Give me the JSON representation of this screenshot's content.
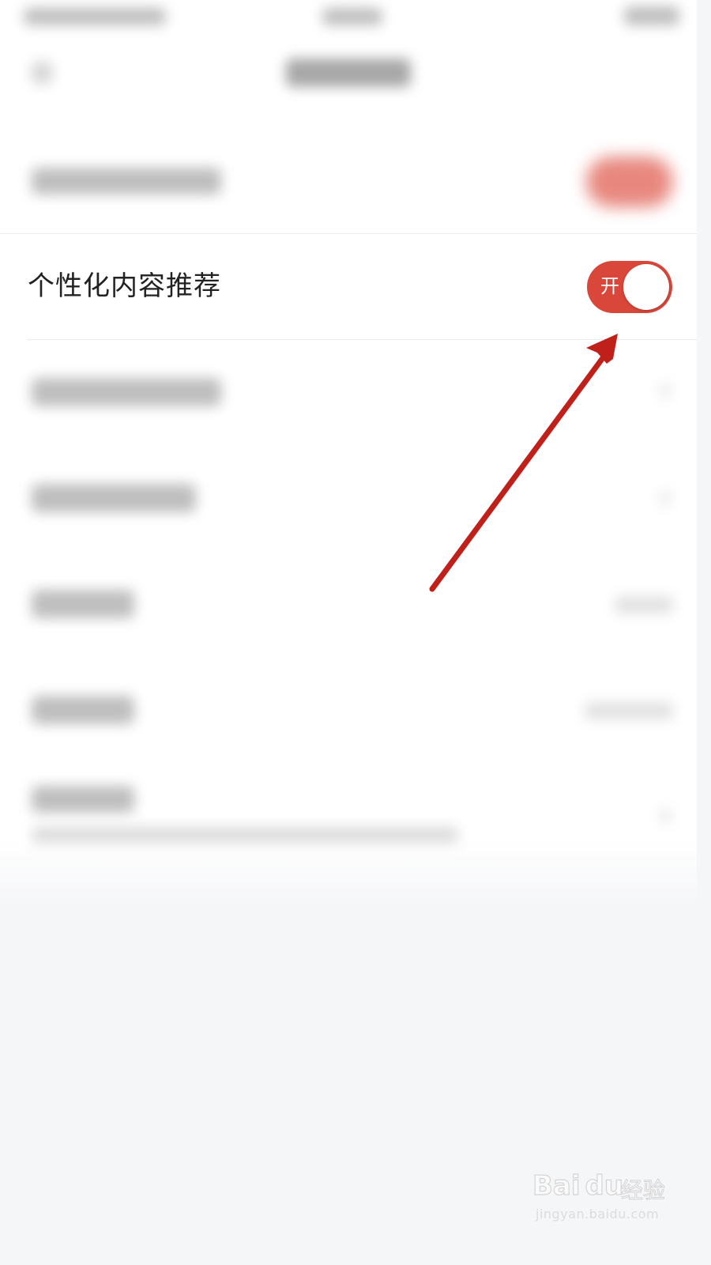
{
  "settings": {
    "personalized_content": {
      "label": "个性化内容推荐",
      "toggle_state_text": "开",
      "enabled": true
    }
  },
  "colors": {
    "toggle_on": "#d9473a",
    "annotation_arrow": "#c0201a",
    "page_background": "#f5f6f8"
  },
  "watermark": {
    "brand_logo": "Bai du 经验",
    "url": "jingyan.baidu.com"
  }
}
